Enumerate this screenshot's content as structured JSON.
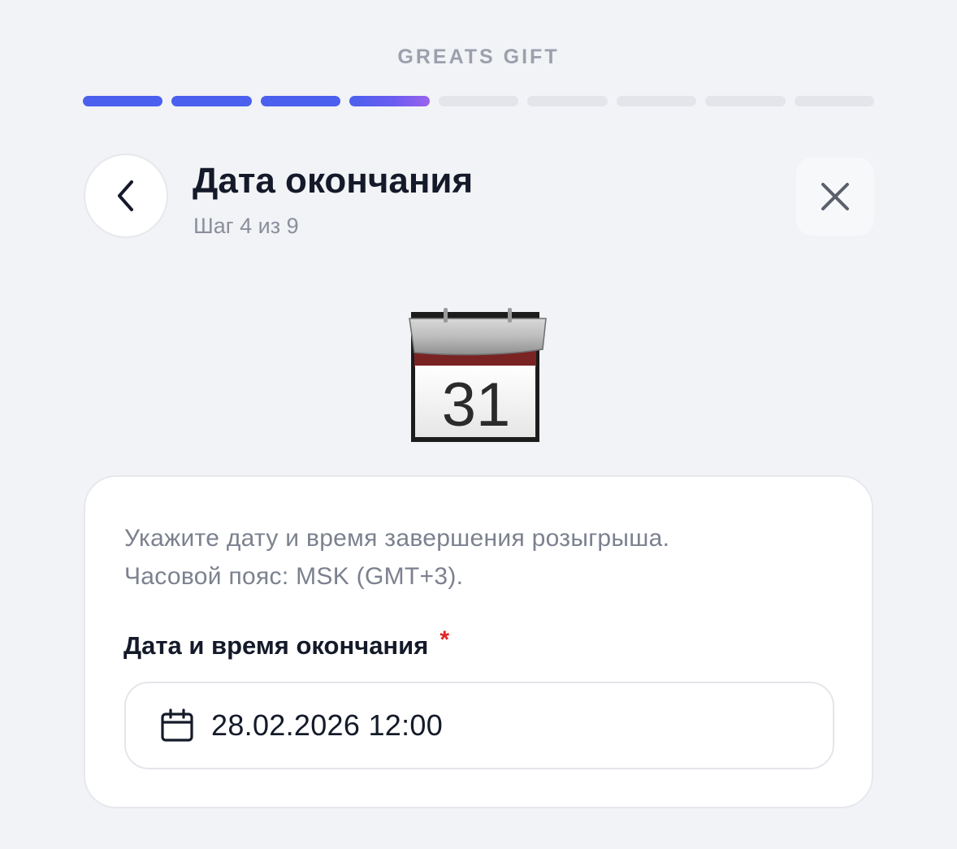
{
  "app": {
    "brand": "GREATS GIFT"
  },
  "progress": {
    "total_steps": 9,
    "completed_steps": 3,
    "current_step": 4,
    "active_color": "#4b60ee",
    "inactive_color": "#e3e5ea"
  },
  "header": {
    "title": "Дата окончания",
    "subtitle": "Шаг 4 из 9",
    "back_icon": "chevron-left-icon",
    "close_icon": "close-icon"
  },
  "illustration": {
    "icon": "calendar-icon",
    "day": "31"
  },
  "form": {
    "description_line1": "Укажите дату и время завершения розыгрыша.",
    "description_line2": "Часовой пояс: MSK (GMT+3).",
    "field_label": "Дата и время окончания",
    "required_mark": "*",
    "field_icon": "calendar-icon",
    "field_value": "28.02.2026 12:00",
    "required_color": "#e02424"
  }
}
